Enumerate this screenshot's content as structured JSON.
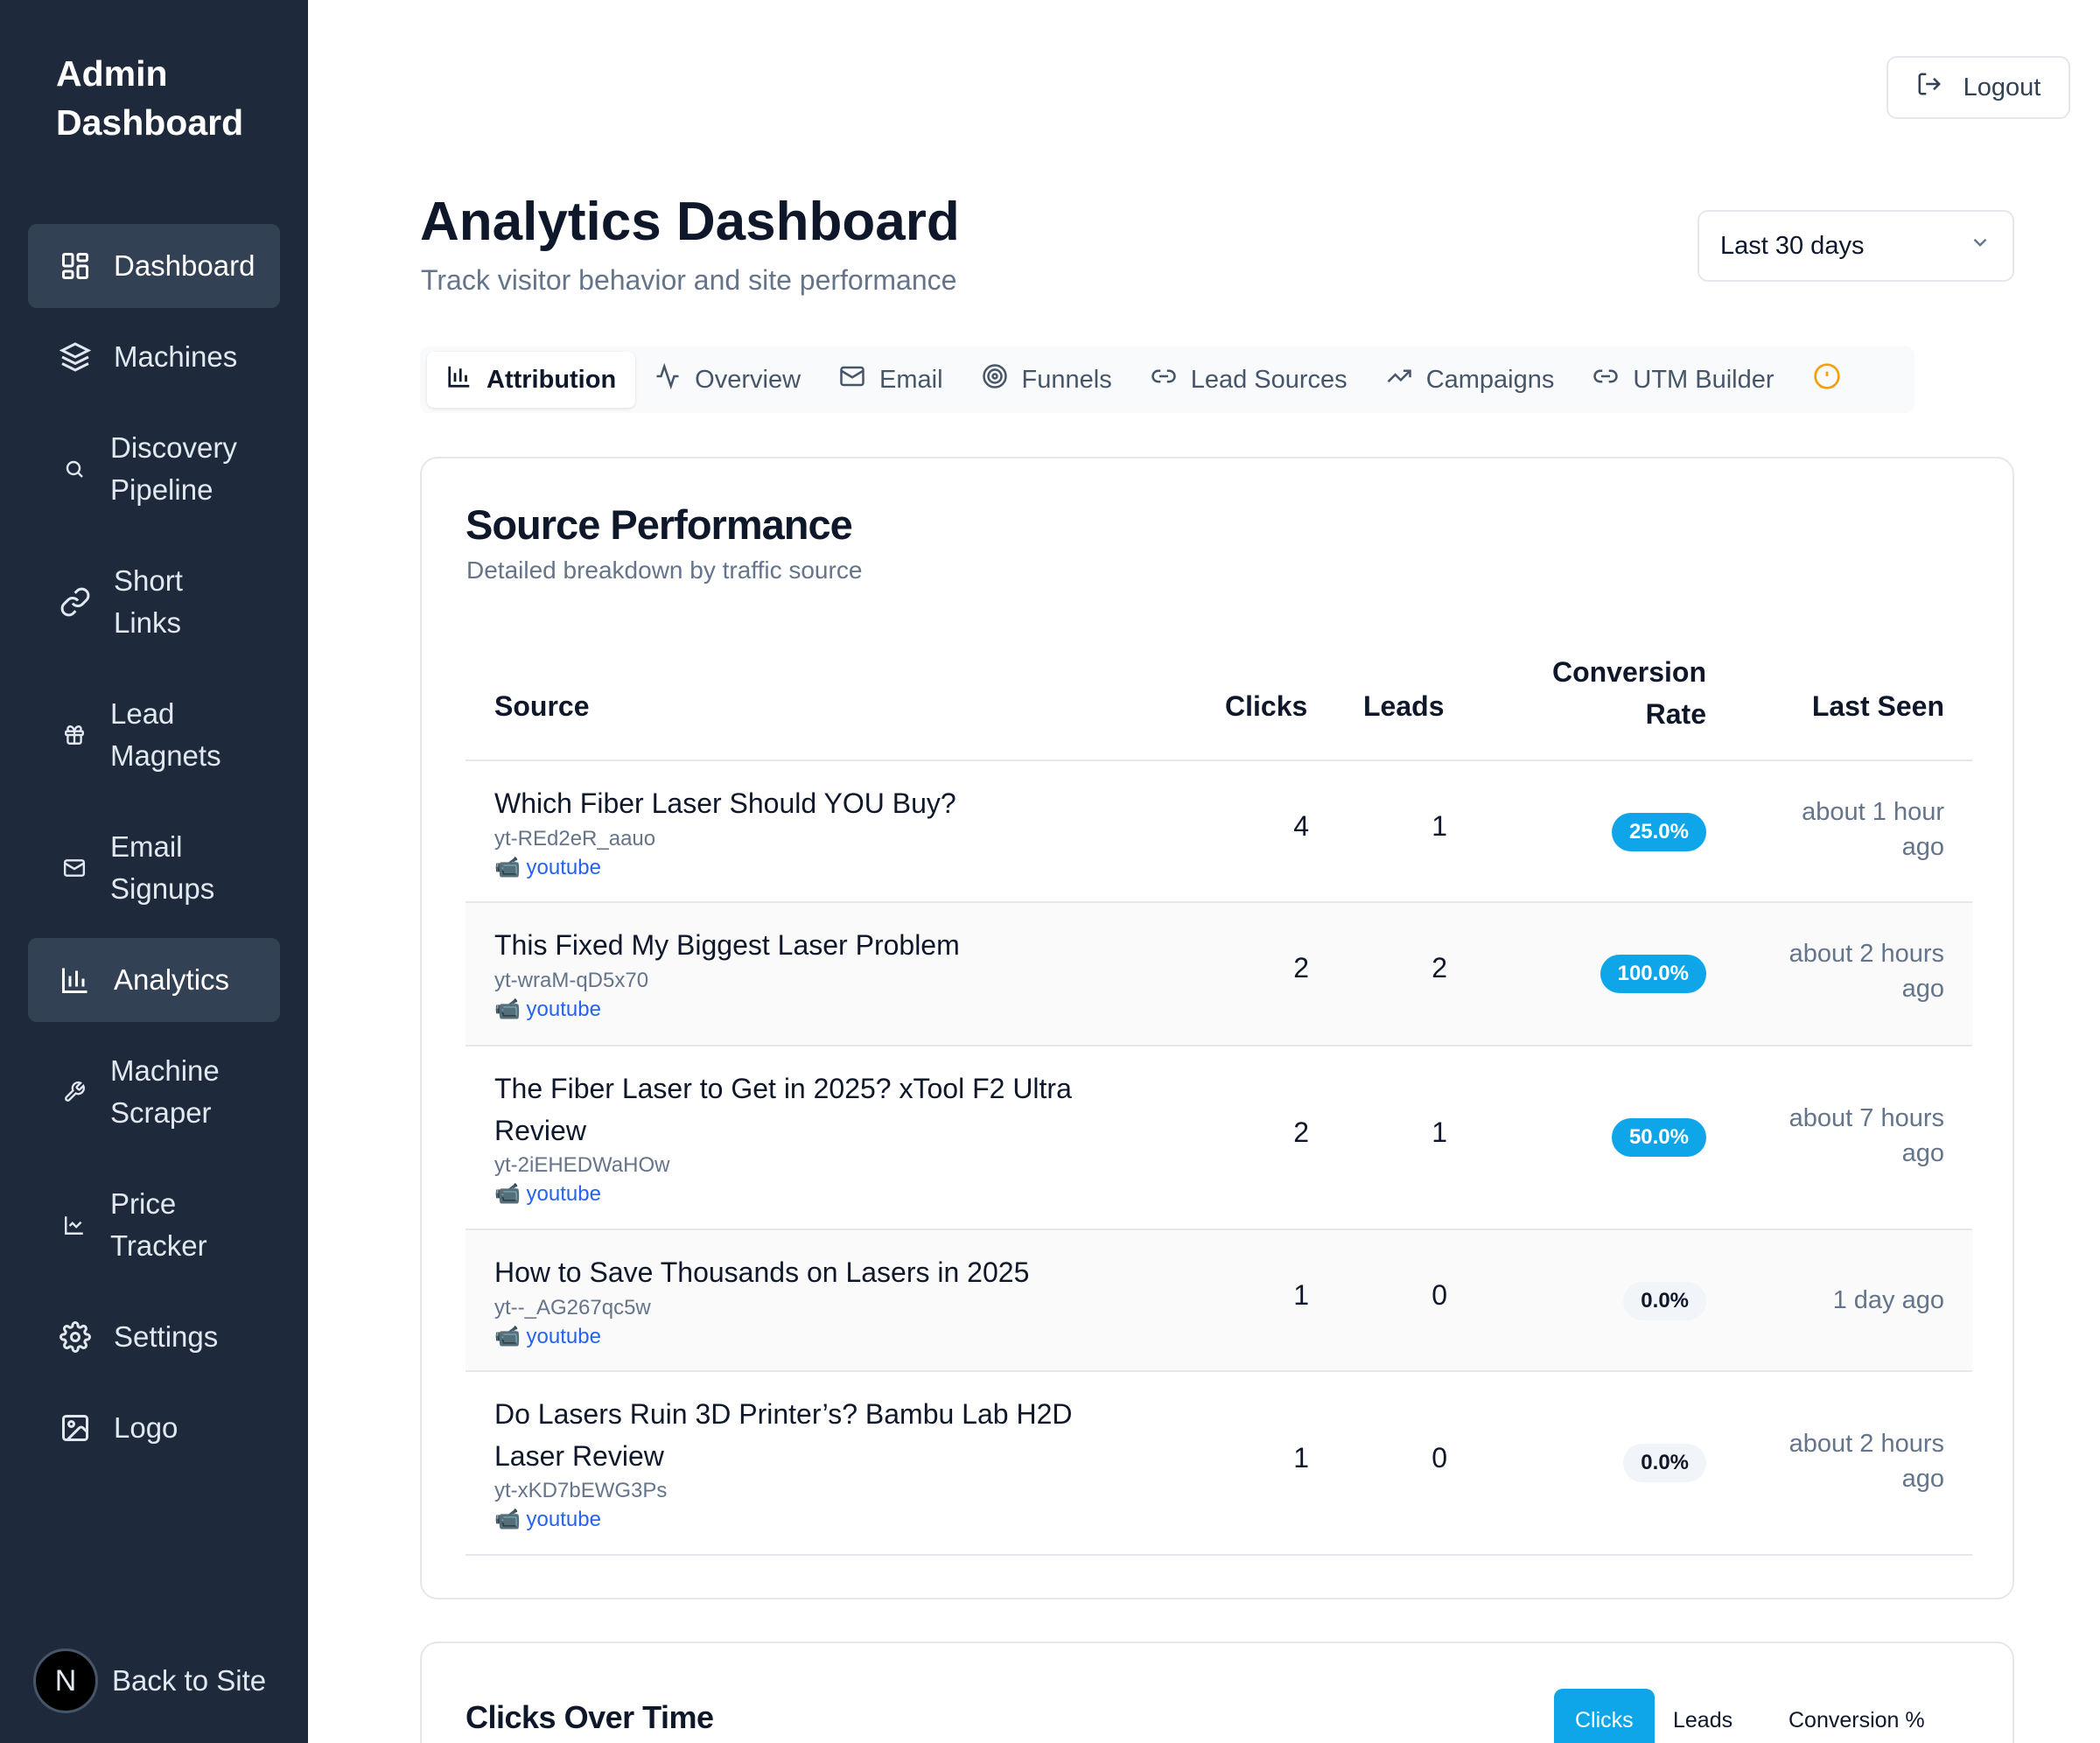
{
  "sidebar": {
    "brand": "Admin Dashboard",
    "items": [
      {
        "label": "Dashboard",
        "icon": "layout-grid-icon",
        "active": true
      },
      {
        "label": "Machines",
        "icon": "layers-icon",
        "active": false
      },
      {
        "label": "Discovery Pipeline",
        "icon": "search-icon",
        "active": false
      },
      {
        "label": "Short Links",
        "icon": "link-icon",
        "active": false
      },
      {
        "label": "Lead Magnets",
        "icon": "gift-icon",
        "active": false
      },
      {
        "label": "Email Signups",
        "icon": "mail-icon",
        "active": false
      },
      {
        "label": "Analytics",
        "icon": "bar-chart-icon",
        "active": true
      },
      {
        "label": "Machine Scraper",
        "icon": "wrench-icon",
        "active": false
      },
      {
        "label": "Price Tracker",
        "icon": "line-chart-icon",
        "active": false
      },
      {
        "label": "Settings",
        "icon": "gear-icon",
        "active": false
      },
      {
        "label": "Logo",
        "icon": "image-icon",
        "active": false
      }
    ],
    "back_label": "Back to Site",
    "avatar_letter": "N"
  },
  "header": {
    "logout_label": "Logout",
    "title": "Analytics Dashboard",
    "subtitle": "Track visitor behavior and site performance",
    "range_value": "Last 30 days"
  },
  "tabs": [
    {
      "label": "Attribution",
      "icon": "bar-chart-icon",
      "active": true
    },
    {
      "label": "Overview",
      "icon": "activity-icon",
      "active": false
    },
    {
      "label": "Email",
      "icon": "mail-icon",
      "active": false
    },
    {
      "label": "Funnels",
      "icon": "target-icon",
      "active": false
    },
    {
      "label": "Lead Sources",
      "icon": "link-icon",
      "active": false
    },
    {
      "label": "Campaigns",
      "icon": "trending-up-icon",
      "active": false
    },
    {
      "label": "UTM Builder",
      "icon": "link-icon",
      "active": false
    },
    {
      "label": "",
      "icon": "alert-circle-icon",
      "active": false
    }
  ],
  "source_performance": {
    "title": "Source Performance",
    "description": "Detailed breakdown by traffic source",
    "columns": {
      "source": "Source",
      "clicks": "Clicks",
      "leads": "Leads",
      "conversion_line1": "Conversion",
      "conversion_line2": "Rate",
      "last_seen": "Last Seen"
    },
    "rows": [
      {
        "title": "Which Fiber Laser Should YOU Buy?",
        "id": "yt-REd2eR_aauo",
        "source": "📹 youtube",
        "clicks": "4",
        "leads": "1",
        "rate": "25.0%",
        "rate_highlight": true,
        "seen_line1": "about 1 hour",
        "seen_line2": "ago"
      },
      {
        "title": "This Fixed My Biggest Laser Problem",
        "id": "yt-wraM-qD5x70",
        "source": "📹 youtube",
        "clicks": "2",
        "leads": "2",
        "rate": "100.0%",
        "rate_highlight": true,
        "seen_line1": "about 2 hours",
        "seen_line2": "ago"
      },
      {
        "title": "The Fiber Laser to Get in 2025? xTool F2 Ultra Review",
        "id": "yt-2iEHEDWaHOw",
        "source": "📹 youtube",
        "clicks": "2",
        "leads": "1",
        "rate": "50.0%",
        "rate_highlight": true,
        "seen_line1": "about 7 hours",
        "seen_line2": "ago"
      },
      {
        "title": "How to Save Thousands on Lasers in 2025",
        "id": "yt--_AG267qc5w",
        "source": "📹 youtube",
        "clicks": "1",
        "leads": "0",
        "rate": "0.0%",
        "rate_highlight": false,
        "seen_line1": "1 day ago",
        "seen_line2": ""
      },
      {
        "title": "Do Lasers Ruin 3D Printer’s? Bambu Lab H2D Laser Review",
        "id": "yt-xKD7bEWG3Ps",
        "source": "📹 youtube",
        "clicks": "1",
        "leads": "0",
        "rate": "0.0%",
        "rate_highlight": false,
        "seen_line1": "about 2 hours",
        "seen_line2": "ago"
      }
    ]
  },
  "clicks_over_time": {
    "title": "Clicks Over Time",
    "toggles": [
      {
        "label": "Clicks",
        "active": true
      },
      {
        "label": "Leads",
        "active": false
      },
      {
        "label": "Conversion %",
        "active": false
      }
    ]
  },
  "colors": {
    "sidebar_bg": "#1e293b",
    "sidebar_active": "#334155",
    "accent": "#0ea5e9",
    "link": "#2563eb",
    "warning": "#f59e0b"
  }
}
